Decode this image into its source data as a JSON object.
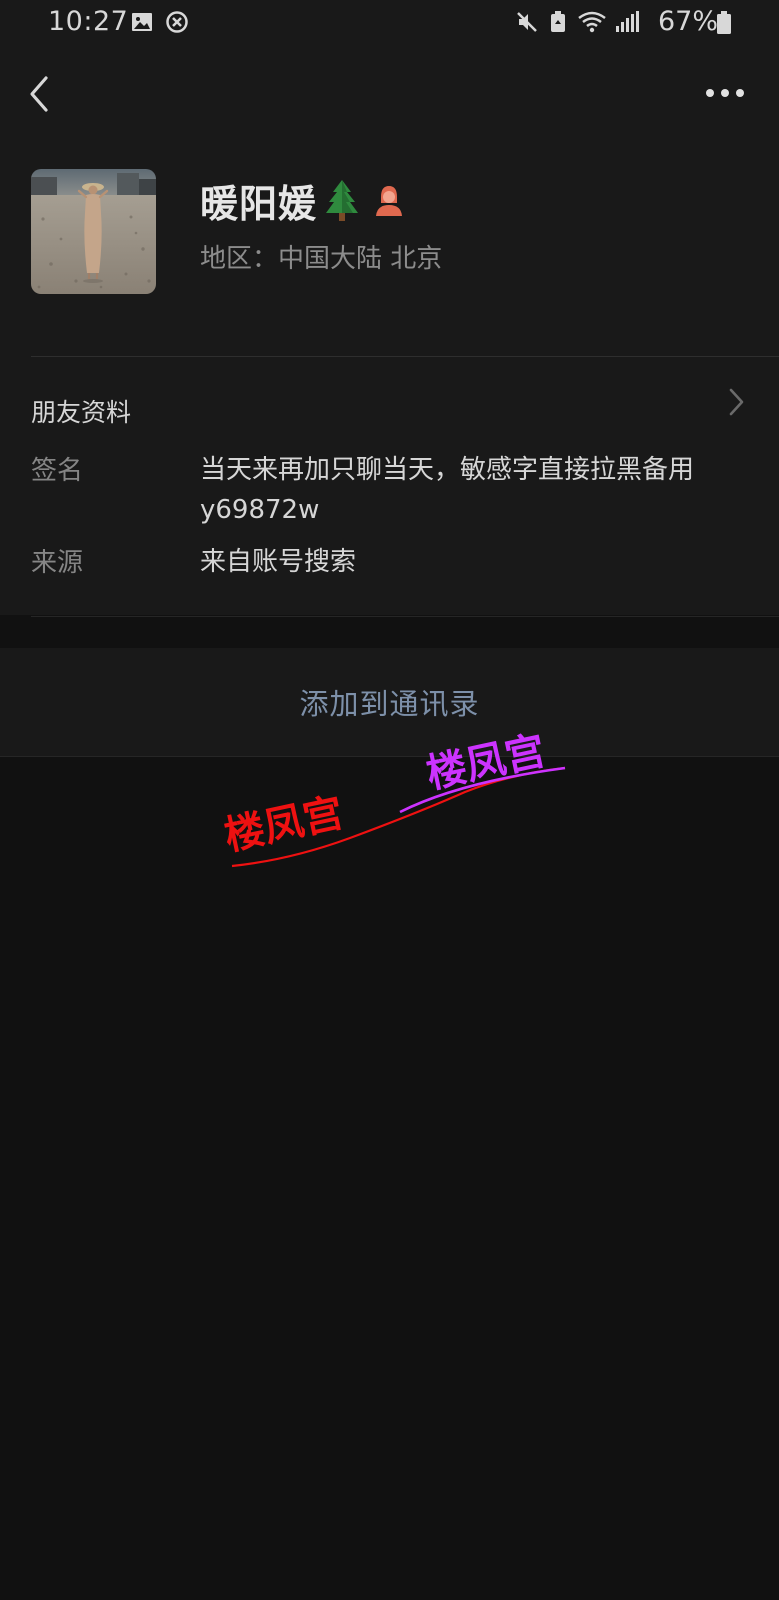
{
  "status_bar": {
    "time": "10:27",
    "battery": "67%",
    "icons": [
      "gallery-icon",
      "blocked-icon",
      "mute-icon",
      "storage-icon",
      "wifi-icon",
      "signal-icon",
      "battery-icon"
    ]
  },
  "header": {
    "back_icon": "chevron-left-icon",
    "more_icon": "more-dots-icon"
  },
  "profile": {
    "nickname": "暖阳媛",
    "emoji": "tree-icon",
    "gender": "female-icon",
    "region": "地区：中国大陆  北京"
  },
  "friend_info": {
    "title": "朋友资料",
    "signature_label": "签名",
    "signature_line1": "当天来再加只聊当天，敏感字直接拉黑备用",
    "signature_line2": "y69872w",
    "source_label": "来源",
    "source_value": "来自账号搜索"
  },
  "actions": {
    "add_contact": "添加到通讯录"
  },
  "watermark": {
    "text_1": "楼凤宫",
    "text_2": "楼凤宫"
  },
  "colors": {
    "background": "#111111",
    "panel": "#191919",
    "link": "#7d90a9",
    "watermark_red": "#ee1111",
    "watermark_purple": "#cc33ff"
  }
}
